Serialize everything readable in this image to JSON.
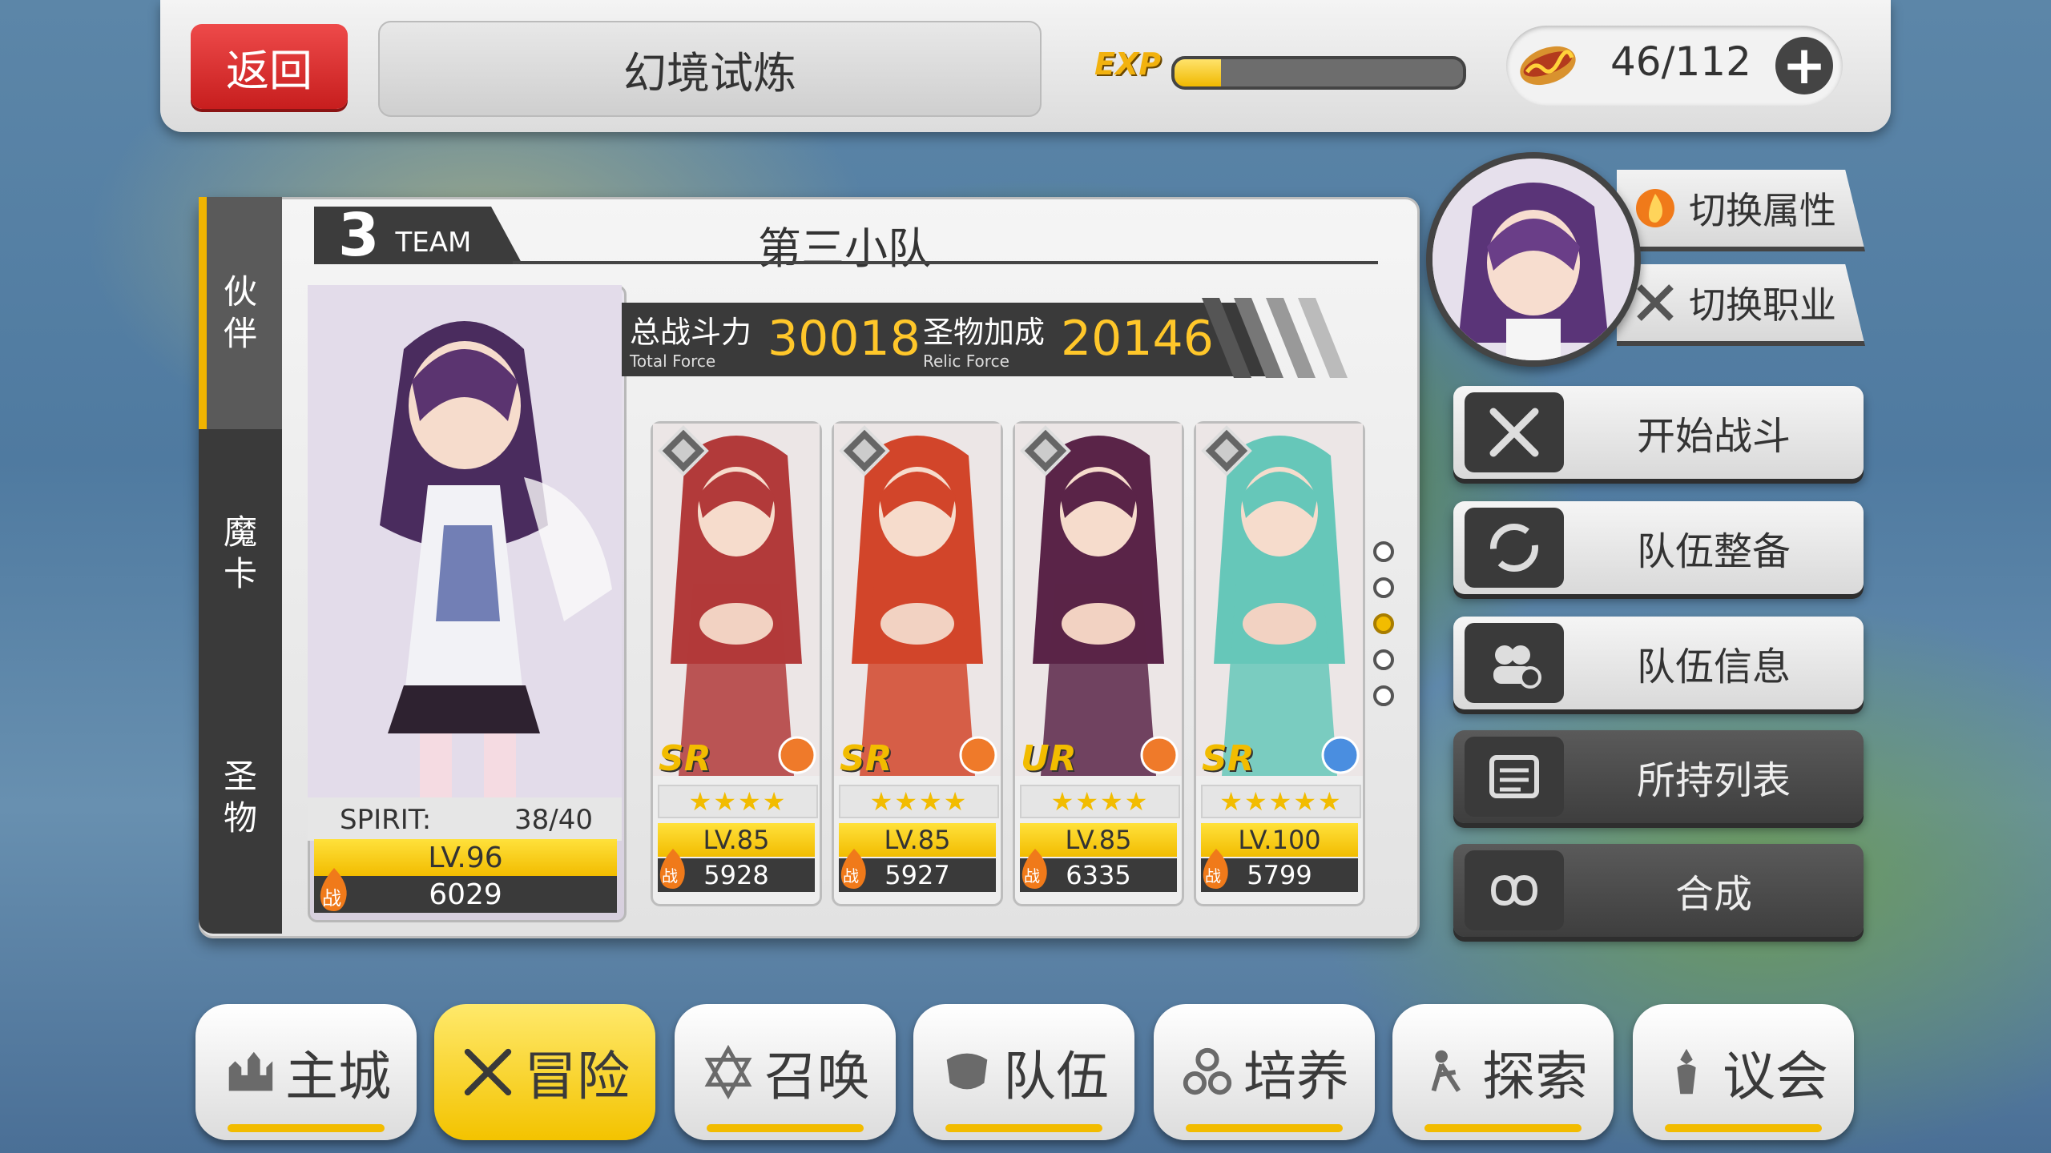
{
  "header": {
    "back_label": "返回",
    "title": "幻境试炼",
    "exp_label": "EXP",
    "exp_progress": 0.16,
    "stamina": "46/112",
    "stamina_icon": "hotdog-icon",
    "add_icon": "plus-icon"
  },
  "side_tabs": [
    {
      "label": "伙\n伴",
      "active": true
    },
    {
      "label": "魔\n卡",
      "active": false
    },
    {
      "label": "圣\n物",
      "active": false
    }
  ],
  "team": {
    "number": "3",
    "team_word": "TEAM",
    "name": "第三小队",
    "total_force_label": "总战斗力",
    "total_force_sub": "Total Force",
    "total_force_value": "30018",
    "relic_force_label": "圣物加成",
    "relic_force_sub": "Relic Force",
    "relic_force_value": "20146"
  },
  "leader": {
    "spirit_label": "SPIRIT:",
    "spirit_value": "38/40",
    "level": "LV.96",
    "power_icon": "战",
    "power": "6029"
  },
  "members": [
    {
      "rarity": "SR",
      "stars": "★★★★",
      "level": "LV.85",
      "power": "5928",
      "power_icon": "战",
      "color": "#b23a3a"
    },
    {
      "rarity": "SR",
      "stars": "★★★★",
      "level": "LV.85",
      "power": "5927",
      "power_icon": "战",
      "color": "#d2452a"
    },
    {
      "rarity": "UR",
      "stars": "★★★★",
      "level": "LV.85",
      "power": "6335",
      "power_icon": "战",
      "color": "#5a2448"
    },
    {
      "rarity": "SR",
      "stars": "★★★★★",
      "level": "LV.100",
      "power": "5799",
      "power_icon": "战",
      "color": "#66c7b9"
    }
  ],
  "page_dots": {
    "count": 5,
    "active_index": 2
  },
  "switch_attr_label": "切换属性",
  "switch_class_label": "切换职业",
  "actions": [
    {
      "label": "开始战斗",
      "icon": "crossed-swords-icon",
      "dark": false
    },
    {
      "label": "队伍整备",
      "icon": "refresh-icon",
      "dark": false
    },
    {
      "label": "队伍信息",
      "icon": "team-info-icon",
      "dark": false
    },
    {
      "label": "所持列表",
      "icon": "list-icon",
      "dark": true
    },
    {
      "label": "合成",
      "icon": "infinity-link-icon",
      "dark": true
    }
  ],
  "bottom_nav": [
    {
      "label": "主城",
      "icon": "castle-icon",
      "active": false
    },
    {
      "label": "冒险",
      "icon": "crossed-swords-icon",
      "active": true
    },
    {
      "label": "召唤",
      "icon": "hexagram-icon",
      "active": false
    },
    {
      "label": "队伍",
      "icon": "team-mask-icon",
      "active": false
    },
    {
      "label": "培养",
      "icon": "growth-icon",
      "active": false
    },
    {
      "label": "探索",
      "icon": "explore-icon",
      "active": false
    },
    {
      "label": "议会",
      "icon": "council-icon",
      "active": false
    }
  ]
}
